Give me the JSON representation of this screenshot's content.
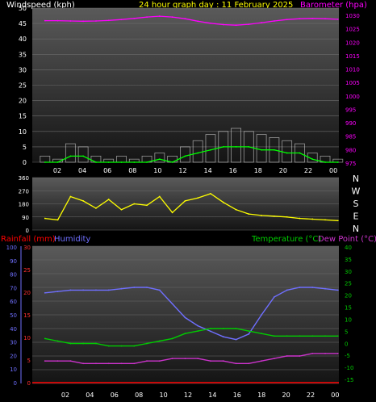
{
  "header": {
    "windspeed_label": "Windspeed (kph)",
    "graph_title": "24 hour graph day : 11 February 2025",
    "barometer_label": "Barometer (hpa)"
  },
  "colors": {
    "background": "#000000",
    "panel_top": "#5a5a5a",
    "panel_bottom": "#151515",
    "title_yellow": "#ffff00",
    "barometer": "#ff00ff",
    "wind_gust": "#ffffff",
    "wind_avg": "#00ff00",
    "direction": "#ffff00",
    "rainfall": "#ff0000",
    "humidity": "#6f6fff",
    "temperature": "#00cc00",
    "dew_point": "#cc33cc"
  },
  "wind_panel": {
    "wind_ticks": [
      "50",
      "45",
      "40",
      "35",
      "30",
      "25",
      "20",
      "15",
      "10",
      "5",
      "0"
    ],
    "baro_ticks": [
      "1030",
      "1025",
      "1020",
      "1015",
      "1010",
      "1005",
      "1000",
      "995",
      "990",
      "985",
      "980",
      "975"
    ],
    "x_ticks": [
      "02",
      "04",
      "06",
      "08",
      "10",
      "12",
      "14",
      "16",
      "18",
      "20",
      "22",
      "00"
    ]
  },
  "direction_panel": {
    "deg_ticks": [
      "360",
      "270",
      "180",
      "90",
      "0"
    ],
    "compass": [
      "N",
      "W",
      "S",
      "E",
      "N"
    ]
  },
  "bottom_panel": {
    "rainfall_label": "Rainfall (mm)",
    "humidity_label": "Humidity",
    "temperature_label": "Temperature (°C)",
    "dewpoint_label": "Dew Point (°C)",
    "humidity_ticks": [
      "100",
      "90",
      "80",
      "70",
      "60",
      "50",
      "40",
      "30",
      "20",
      "10",
      "0"
    ],
    "rain_ticks": [
      "30",
      "25",
      "20",
      "15",
      "10",
      "5",
      "0"
    ],
    "temp_ticks": [
      "40",
      "35",
      "30",
      "25",
      "20",
      "15",
      "10",
      "5",
      "0",
      "-5",
      "-10",
      "-15"
    ],
    "x_ticks": [
      "02",
      "04",
      "06",
      "08",
      "10",
      "12",
      "14",
      "16",
      "18",
      "20",
      "22",
      "00"
    ]
  },
  "chart_data": [
    {
      "type": "line",
      "title": "24 hour graph day : 11 February 2025",
      "xlabel": "",
      "ylabel": "Windspeed (kph)",
      "y2label": "Barometer (hpa)",
      "ylim": [
        0,
        50
      ],
      "y2lim": [
        975,
        1030
      ],
      "x": [
        "01",
        "02",
        "03",
        "04",
        "05",
        "06",
        "07",
        "08",
        "09",
        "10",
        "11",
        "12",
        "13",
        "14",
        "15",
        "16",
        "17",
        "18",
        "19",
        "20",
        "21",
        "22",
        "23",
        "00"
      ],
      "series": [
        {
          "name": "Barometer (hpa)",
          "axis": "right",
          "values": [
            1025.5,
            1025.5,
            1025.4,
            1025.3,
            1025.4,
            1025.6,
            1025.9,
            1026.3,
            1026.8,
            1027.1,
            1026.8,
            1026.2,
            1025.3,
            1024.6,
            1024.1,
            1023.9,
            1024.2,
            1024.8,
            1025.4,
            1025.9,
            1026.2,
            1026.3,
            1026.2,
            1026.0
          ]
        },
        {
          "axis": "left",
          "values": [
            2,
            1,
            6,
            5,
            2,
            1,
            2,
            1,
            2,
            3,
            2,
            5,
            7,
            9,
            10,
            11,
            10,
            9,
            8,
            7,
            6,
            3,
            2,
            1
          ]
        },
        {
          "axis": "left",
          "values": [
            0,
            0,
            2,
            2,
            0,
            0,
            0,
            0,
            0,
            1,
            0,
            2,
            3,
            4,
            5,
            5,
            5,
            4,
            4,
            3,
            3,
            1,
            0,
            0
          ]
        }
      ]
    },
    {
      "type": "line",
      "title": "",
      "ylabel": "",
      "ylim": [
        0,
        360
      ],
      "x": [
        "01",
        "02",
        "03",
        "04",
        "05",
        "06",
        "07",
        "08",
        "09",
        "10",
        "11",
        "12",
        "13",
        "14",
        "15",
        "16",
        "17",
        "18",
        "19",
        "20",
        "21",
        "22",
        "23",
        "00"
      ],
      "series": [
        {
          "values": [
            80,
            70,
            230,
            200,
            150,
            210,
            140,
            180,
            170,
            230,
            120,
            200,
            220,
            250,
            190,
            140,
            110,
            100,
            95,
            90,
            80,
            75,
            70,
            65
          ]
        }
      ]
    },
    {
      "type": "line",
      "title": "",
      "ylabel": "Humidity",
      "y2label": "Temperature (°C)",
      "ylim": [
        0,
        100
      ],
      "y2lim": [
        -15,
        40
      ],
      "x": [
        "01",
        "02",
        "03",
        "04",
        "05",
        "06",
        "07",
        "08",
        "09",
        "10",
        "11",
        "12",
        "13",
        "14",
        "15",
        "16",
        "17",
        "18",
        "19",
        "20",
        "21",
        "22",
        "23",
        "00"
      ],
      "series": [
        {
          "name": "Rainfall (mm)",
          "axis": "rain",
          "values": [
            0,
            0,
            0,
            0,
            0,
            0,
            0,
            0,
            0,
            0,
            0,
            0,
            0,
            0,
            0,
            0,
            0,
            0,
            0,
            0,
            0,
            0,
            0,
            0
          ]
        },
        {
          "name": "Humidity",
          "axis": "left",
          "values": [
            66,
            67,
            68,
            68,
            68,
            68,
            69,
            70,
            70,
            68,
            58,
            48,
            42,
            38,
            34,
            32,
            36,
            50,
            63,
            68,
            70,
            70,
            69,
            68
          ]
        },
        {
          "name": "Temperature (°C)",
          "axis": "right",
          "values": [
            3,
            2,
            1,
            1,
            1,
            0,
            0,
            0,
            1,
            2,
            3,
            5,
            6,
            7,
            7,
            7,
            6,
            5,
            4,
            4,
            4,
            4,
            4,
            4
          ]
        },
        {
          "name": "Dew Point (°C)",
          "axis": "right",
          "values": [
            -6,
            -6,
            -6,
            -7,
            -7,
            -7,
            -7,
            -7,
            -6,
            -6,
            -5,
            -5,
            -5,
            -6,
            -6,
            -7,
            -7,
            -6,
            -5,
            -4,
            -4,
            -3,
            -3,
            -3
          ]
        }
      ]
    }
  ]
}
